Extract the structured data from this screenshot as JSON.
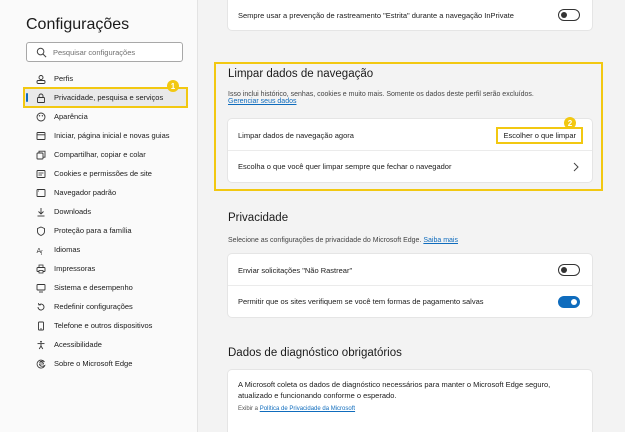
{
  "sidebar": {
    "title": "Configurações",
    "search_placeholder": "Pesquisar configurações",
    "items": [
      {
        "label": "Perfis",
        "icon": "profile-icon"
      },
      {
        "label": "Privacidade, pesquisa e serviços",
        "icon": "lock-icon",
        "active": true
      },
      {
        "label": "Aparência",
        "icon": "appearance-icon"
      },
      {
        "label": "Iniciar, página inicial e novas guias",
        "icon": "home-tabs-icon"
      },
      {
        "label": "Compartilhar, copiar e colar",
        "icon": "share-icon"
      },
      {
        "label": "Cookies e permissões de site",
        "icon": "cookie-icon"
      },
      {
        "label": "Navegador padrão",
        "icon": "browser-icon"
      },
      {
        "label": "Downloads",
        "icon": "download-icon"
      },
      {
        "label": "Proteção para a família",
        "icon": "family-icon"
      },
      {
        "label": "Idiomas",
        "icon": "language-icon"
      },
      {
        "label": "Impressoras",
        "icon": "printer-icon"
      },
      {
        "label": "Sistema e desempenho",
        "icon": "system-icon"
      },
      {
        "label": "Redefinir configurações",
        "icon": "reset-icon"
      },
      {
        "label": "Telefone e outros dispositivos",
        "icon": "phone-icon"
      },
      {
        "label": "Acessibilidade",
        "icon": "accessibility-icon"
      },
      {
        "label": "Sobre o Microsoft Edge",
        "icon": "edge-icon"
      }
    ],
    "badge": "1"
  },
  "top_card": {
    "strict_tracking_label": "Sempre usar a prevenção de rastreamento \"Estrita\" durante a navegação InPrivate",
    "strict_tracking_on": false
  },
  "clear_data": {
    "title": "Limpar dados de navegação",
    "description": "Isso inclui histórico, senhas, cookies e muito mais. Somente os dados deste perfil serão excluídos.",
    "manage_link": "Gerenciar seus dados",
    "clear_now_label": "Limpar dados de navegação agora",
    "choose_button": "Escolher o que limpar",
    "on_close_label": "Escolha o que você quer limpar sempre que fechar o navegador",
    "badge": "2"
  },
  "privacy": {
    "title": "Privacidade",
    "description": "Selecione as configurações de privacidade do Microsoft Edge.",
    "learn_more": "Saiba mais",
    "do_not_track_label": "Enviar solicitações \"Não Rastrear\"",
    "do_not_track_on": false,
    "payment_label": "Permitir que os sites verifiquem se você tem formas de pagamento salvas",
    "payment_on": true
  },
  "diagnostics": {
    "title": "Dados de diagnóstico obrigatórios",
    "text": "A Microsoft coleta os dados de diagnóstico necessários para manter o Microsoft Edge seguro, atualizado e funcionando conforme o esperado.",
    "show_prefix": "Exibir a",
    "policy_link": "Política de Privacidade da Microsoft"
  },
  "colors": {
    "accent": "#0f6cbd",
    "highlight": "#f2c811"
  }
}
